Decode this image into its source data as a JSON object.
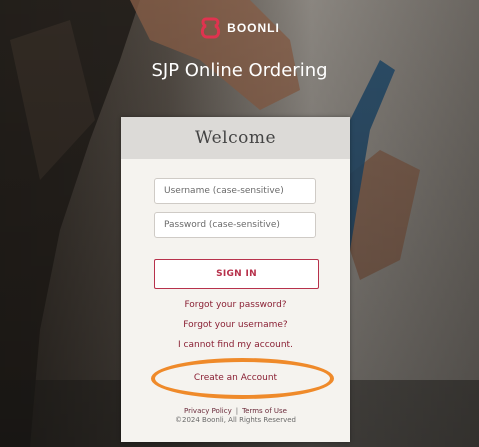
{
  "brand": {
    "name": "BOONLI",
    "logo_icon": "boonli-logo-icon",
    "accent_color": "#e0334f"
  },
  "app": {
    "title": "SJP Online Ordering"
  },
  "login": {
    "heading": "Welcome",
    "username_placeholder": "Username (case-sensitive)",
    "password_placeholder": "Password (case-sensitive)",
    "signin_label": "SIGN IN",
    "forgot_password": "Forgot your password?",
    "forgot_username": "Forgot your username?",
    "cannot_find_account": "I cannot find my account.",
    "create_account": "Create an Account",
    "button_color": "#b7314b"
  },
  "footer": {
    "privacy_policy": "Privacy Policy",
    "separator": "|",
    "terms_of_use": "Terms of Use",
    "copyright": "©2024 Boonli, All Rights Reserved"
  },
  "annotation": {
    "highlight_color": "#ef8a2a"
  }
}
